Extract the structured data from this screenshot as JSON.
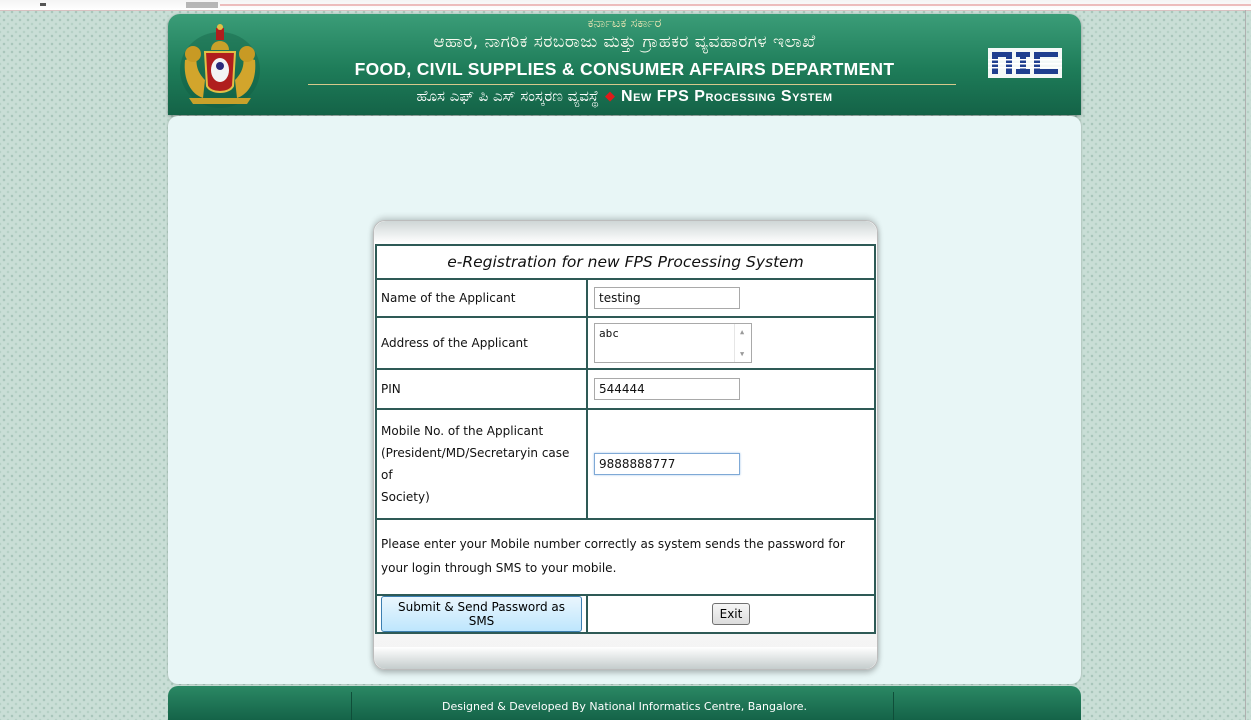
{
  "header": {
    "state_kn": "ಕರ್ನಾಟಕ ಸರ್ಕಾರ",
    "dept_kn": "ಆಹಾರ, ನಾಗರಿಕ ಸರಬರಾಜು ಮತ್ತು ಗ್ರಾಹಕರ ವ್ಯವಹಾರಗಳ ಇಲಾಖೆ",
    "dept_en": "FOOD, CIVIL SUPPLIES & CONSUMER AFFAIRS DEPARTMENT",
    "system_kn": "ಹೊಸ ಎಫ್ ಪಿ ಎಸ್ ಸಂಸ್ಕರಣ ವ್ಯವಸ್ಥೆ",
    "system_en": "New FPS Processing System",
    "emblem_icon": "karnataka-emblem-icon",
    "nic_logo_text": "NIC"
  },
  "form": {
    "title": "e-Registration for new FPS Processing System",
    "name_label": "Name of the Applicant",
    "name_value": "testing",
    "address_label": "Address of the Applicant",
    "address_value": "abc",
    "pin_label": "PIN",
    "pin_value": "544444",
    "mobile_label_line1": "Mobile No. of the Applicant",
    "mobile_label_line2": "(President/MD/Secretaryin case of",
    "mobile_label_line3": "Society)",
    "mobile_value": "9888888777",
    "message": "Please enter your Mobile number correctly as system sends the password for your login through SMS to your mobile.",
    "submit_label": "Submit & Send Password as SMS",
    "exit_label": "Exit"
  },
  "footer": {
    "text": "Designed & Developed By National Informatics Centre, Bangalore."
  },
  "colors": {
    "header_green": "#1e7c59",
    "title_blue": "#3020b0",
    "warning_red": "#e0201a",
    "content_bg": "#e8f6f6"
  }
}
